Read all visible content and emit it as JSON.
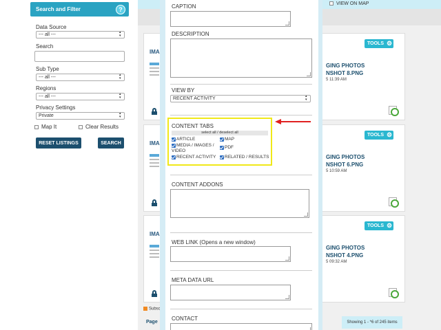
{
  "sidebar": {
    "title": "Search and Filter",
    "help_glyph": "?",
    "data_source": {
      "label": "Data Source",
      "value": "--- all ---"
    },
    "search": {
      "label": "Search",
      "value": ""
    },
    "sub_type": {
      "label": "Sub Type",
      "value": "--- all ---"
    },
    "regions": {
      "label": "Regions",
      "value": "--- all ---"
    },
    "privacy": {
      "label": "Privacy Settings",
      "value": "Private"
    },
    "map_it_label": "Map It",
    "clear_results_label": "Clear Results",
    "reset_button": "RESET LISTINGS",
    "search_button": "SEARCH"
  },
  "listing": {
    "view_on_map": "VIEW ON MAP",
    "cards": [
      {
        "prefix": "IMA",
        "tools": "TOOLS",
        "title_line1": "GING PHOTOS",
        "title_line2": "NSHOT 8.PNG",
        "date": "5 11:39 AM"
      },
      {
        "prefix": "IMA",
        "tools": "TOOLS",
        "title_line1": "GING PHOTOS",
        "title_line2": "NSHOT 6.PNG",
        "date": "5 10:59 AM"
      },
      {
        "prefix": "IMA",
        "tools": "TOOLS",
        "title_line1": "GING PHOTOS",
        "title_line2": "NSHOT 4.PNG",
        "date": "5 09:32 AM"
      }
    ],
    "subscribe_text": "Subsc",
    "page_label": "Page",
    "showing_text": "Showing 1 - *6 of 245 items"
  },
  "form": {
    "caption_label": "CAPTION",
    "description_label": "DESCRIPTION",
    "view_by_label": "VIEW BY",
    "view_by_value": "RECENT ACTIVITY",
    "content_tabs_label": "CONTENT TABS",
    "select_all_text": "select all / deselect all",
    "tabs": {
      "article": "ARTICLE",
      "map": "MAP",
      "media_line1": "MEDIA / IMAGES /",
      "media_line2": "VIDEO",
      "pdf": "PDF",
      "recent_activity": "RECENT ACTIVITY",
      "related": "RELATED / RESULTS"
    },
    "content_addons_label": "CONTENT ADDONS",
    "web_link_label": "WEB LINK (Opens a new window)",
    "meta_data_label": "META DATA URL",
    "contact_label": "CONTACT"
  },
  "colors": {
    "header_teal": "#2aa3c2",
    "dark_button": "#1c4f6e",
    "highlight_yellow": "#f0e818",
    "arrow_red": "#e02020"
  }
}
